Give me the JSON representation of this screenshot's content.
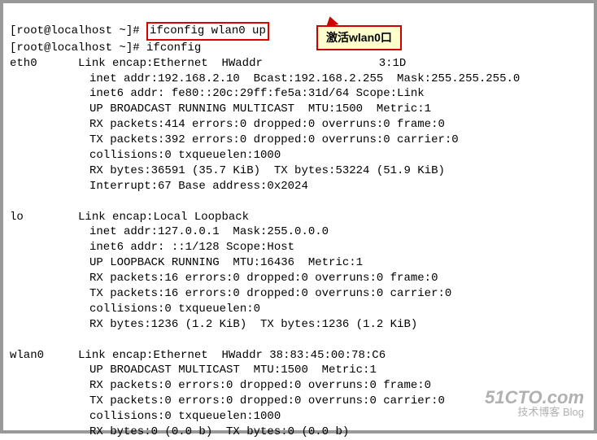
{
  "prompt1": {
    "prefix": "[root@localhost ~]# ",
    "command": "ifconfig wlan0 up"
  },
  "prompt2": {
    "prefix": "[root@localhost ~]# ",
    "command": "ifconfig"
  },
  "callout": {
    "text": "激活wlan0口"
  },
  "ifaces": [
    {
      "name": "eth0",
      "lines": [
        "Link encap:Ethernet  HWaddr                 3:1D",
        "inet addr:192.168.2.10  Bcast:192.168.2.255  Mask:255.255.255.0",
        "inet6 addr: fe80::20c:29ff:fe5a:31d/64 Scope:Link",
        "UP BROADCAST RUNNING MULTICAST  MTU:1500  Metric:1",
        "RX packets:414 errors:0 dropped:0 overruns:0 frame:0",
        "TX packets:392 errors:0 dropped:0 overruns:0 carrier:0",
        "collisions:0 txqueuelen:1000",
        "RX bytes:36591 (35.7 KiB)  TX bytes:53224 (51.9 KiB)",
        "Interrupt:67 Base address:0x2024"
      ]
    },
    {
      "name": "lo",
      "lines": [
        "Link encap:Local Loopback",
        "inet addr:127.0.0.1  Mask:255.0.0.0",
        "inet6 addr: ::1/128 Scope:Host",
        "UP LOOPBACK RUNNING  MTU:16436  Metric:1",
        "RX packets:16 errors:0 dropped:0 overruns:0 frame:0",
        "TX packets:16 errors:0 dropped:0 overruns:0 carrier:0",
        "collisions:0 txqueuelen:0",
        "RX bytes:1236 (1.2 KiB)  TX bytes:1236 (1.2 KiB)"
      ]
    },
    {
      "name": "wlan0",
      "lines": [
        "Link encap:Ethernet  HWaddr 38:83:45:00:78:C6",
        "UP BROADCAST MULTICAST  MTU:1500  Metric:1",
        "RX packets:0 errors:0 dropped:0 overruns:0 frame:0",
        "TX packets:0 errors:0 dropped:0 overruns:0 carrier:0",
        "collisions:0 txqueuelen:1000",
        "RX bytes:0 (0.0 b)  TX bytes:0 (0.0 b)"
      ]
    }
  ],
  "watermark": {
    "main": "51CTO.com",
    "sub": "技术博客    Blog"
  }
}
